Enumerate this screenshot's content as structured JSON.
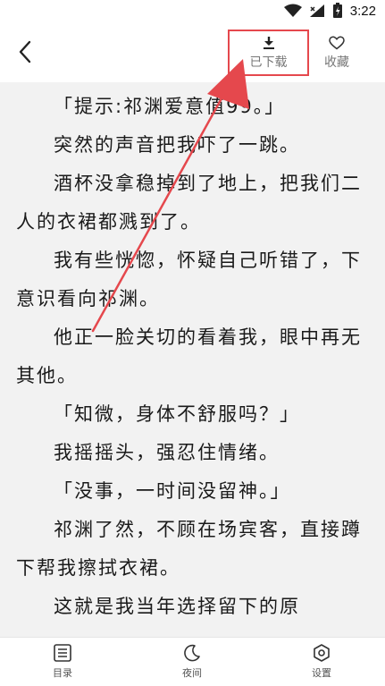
{
  "status_bar": {
    "time": "3:22"
  },
  "top_bar": {
    "download_label": "已下载",
    "favorite_label": "收藏"
  },
  "content": {
    "paragraphs": [
      "「提示:祁渊爱意值99。」",
      "突然的声音把我吓了一跳。",
      "酒杯没拿稳掉到了地上，把我们二人的衣裙都溅到了。",
      "我有些恍惚，怀疑自己听错了，下意识看向祁渊。",
      "他正一脸关切的看着我，眼中再无其他。",
      "「知微，身体不舒服吗？」",
      "我摇摇头，强忍住情绪。",
      "「没事，一时间没留神。」",
      "祁渊了然，不顾在场宾客，直接蹲下帮我擦拭衣裙。",
      "这就是我当年选择留下的原"
    ]
  },
  "bottom_nav": {
    "catalog_label": "目录",
    "night_label": "夜间",
    "settings_label": "设置"
  },
  "colors": {
    "highlight_red": "#e5484d",
    "reader_bg": "#f2f2f2"
  },
  "icons": [
    "wifi-icon",
    "signal-icon",
    "battery-icon",
    "back-icon",
    "download-icon",
    "heart-icon",
    "list-icon",
    "moon-icon",
    "settings-icon"
  ]
}
